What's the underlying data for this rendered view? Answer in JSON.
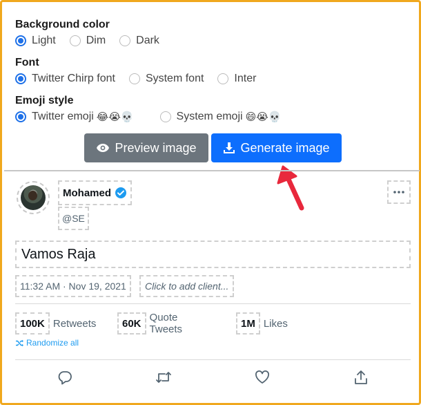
{
  "settings": {
    "background": {
      "title": "Background color",
      "options": [
        "Light",
        "Dim",
        "Dark"
      ],
      "selected": "Light"
    },
    "font": {
      "title": "Font",
      "options": [
        "Twitter Chirp font",
        "System font",
        "Inter"
      ],
      "selected": "Twitter Chirp font"
    },
    "emoji": {
      "title": "Emoji style",
      "options": [
        "Twitter emoji",
        "System emoji"
      ],
      "twitter_emoji_sample": "😂😭💀",
      "system_emoji_sample": "😄😭💀",
      "selected": "Twitter emoji"
    }
  },
  "buttons": {
    "preview_label": "Preview image",
    "generate_label": "Generate image"
  },
  "tweet": {
    "name": "Mohamed",
    "handle": "@SE",
    "text": "Vamos Raja",
    "datetime": "11:32 AM · Nov 19, 2021",
    "client_placeholder": "Click to add client..."
  },
  "stats": {
    "retweets_value": "100K",
    "retweets_label": "Retweets",
    "quotes_value": "60K",
    "quotes_label": "Quote Tweets",
    "likes_value": "1M",
    "likes_label": "Likes"
  },
  "randomize_label": "Randomize all",
  "icons": {
    "preview": "eye-icon",
    "generate": "download-icon",
    "verified": "verified-badge-icon",
    "more": "more-dots-icon",
    "randomize": "shuffle-icon",
    "reply": "reply-icon",
    "retweet": "retweet-icon",
    "like": "heart-icon",
    "share": "share-icon"
  },
  "colors": {
    "primary": "#0d6efd",
    "secondary": "#6c757d",
    "frame": "#f0a81e",
    "arrow": "#e8283c",
    "twitter_blue": "#1d9bf0"
  }
}
